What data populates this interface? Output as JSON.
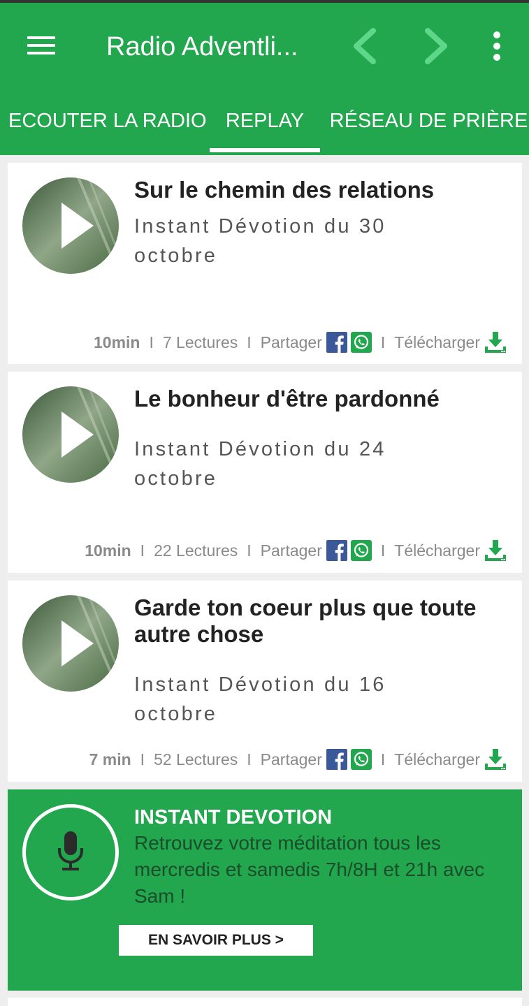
{
  "app": {
    "title": "Radio Adventli...",
    "accent": "#22a74e"
  },
  "toolbar": {
    "menu_icon": "hamburger-menu-icon",
    "prev_icon": "chevron-left-icon",
    "next_icon": "chevron-right-icon",
    "more_icon": "more-vertical-icon"
  },
  "tabs": [
    {
      "label": "ECOUTER LA RADIO",
      "active": false
    },
    {
      "label": "REPLAY",
      "active": true
    },
    {
      "label": "RÉSEAU DE PRIÈRE",
      "active": false
    }
  ],
  "episodes": [
    {
      "title": "Sur le chemin des relations",
      "subtitle": "Instant Dévotion du 30 octobre",
      "duration": "10min",
      "reads": "7 Lectures",
      "share_label": "Partager",
      "download_label": "Télécharger"
    },
    {
      "title": "Le bonheur d'être pardonné",
      "subtitle": "Instant Dévotion du 24 octobre",
      "duration": "10min",
      "reads": "22 Lectures",
      "share_label": "Partager",
      "download_label": "Télécharger"
    },
    {
      "title": "Garde ton coeur plus que toute autre chose",
      "subtitle": "Instant Dévotion du 16 octobre",
      "duration": "7 min",
      "reads": "52 Lectures",
      "share_label": "Partager",
      "download_label": "Télécharger"
    }
  ],
  "separator": "I",
  "promo": {
    "title": "INSTANT DEVOTION",
    "text": "Retrouvez votre méditation tous les mercredis et samedis 7h/8H et 21h avec Sam !",
    "button": "EN SAVOIR PLUS >",
    "icon": "microphone-icon"
  }
}
